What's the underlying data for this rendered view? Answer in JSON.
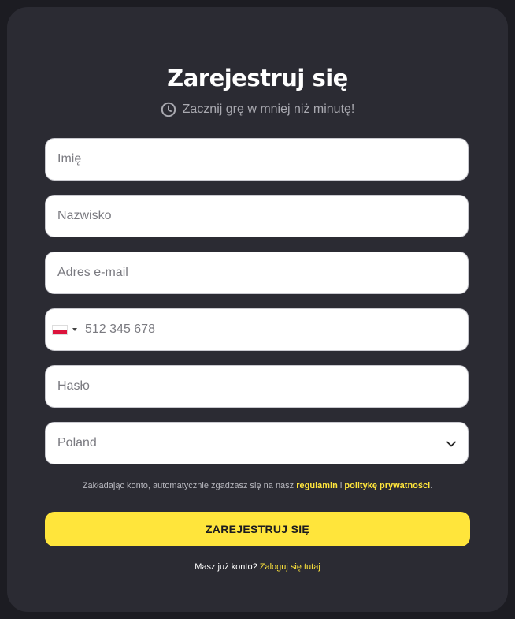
{
  "header": {
    "title": "Zarejestruj się",
    "subtitle": "Zacznij grę w mniej niż minutę!",
    "subtitle_icon": "clock-icon"
  },
  "form": {
    "first_name_placeholder": "Imię",
    "last_name_placeholder": "Nazwisko",
    "email_placeholder": "Adres e-mail",
    "phone": {
      "country_flag": "PL",
      "placeholder": "512 345 678"
    },
    "password_placeholder": "Hasło",
    "country": {
      "selected": "Poland",
      "icon": "chevron-down-icon"
    }
  },
  "terms": {
    "prefix": "Zakładając konto, automatycznie zgadzasz się na nasz ",
    "regulations_link": "regulamin",
    "conjunction": " i ",
    "privacy_link": "politykę prywatności",
    "suffix": "."
  },
  "submit_label": "ZAREJESTRUJ SIĘ",
  "login": {
    "prompt": "Masz już konto? ",
    "link": "Zaloguj się tutaj"
  },
  "colors": {
    "background": "#1c1c22",
    "card": "#2b2b33",
    "accent": "#ffe53b",
    "input_bg": "#ffffff"
  }
}
